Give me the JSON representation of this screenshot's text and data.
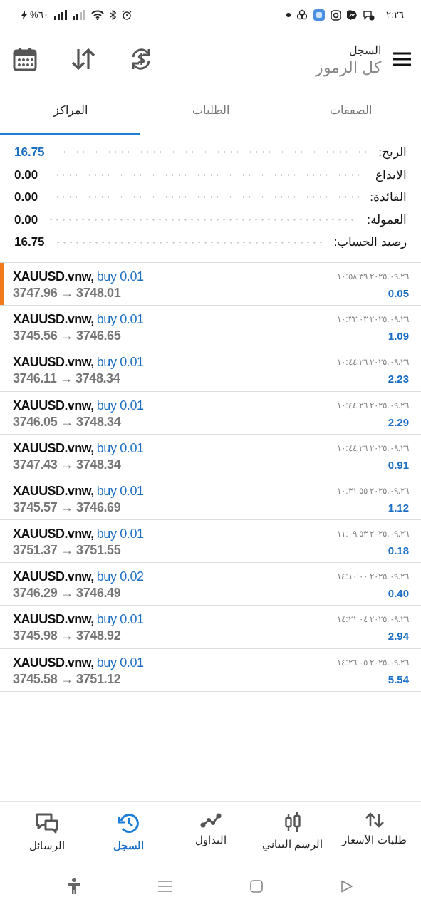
{
  "status_bar": {
    "time": "٢:٢٦",
    "battery": "%٦٠"
  },
  "header": {
    "title": "السجل",
    "subtitle": "كل الرموز"
  },
  "tabs": [
    {
      "label": "الصفقات",
      "selected": false
    },
    {
      "label": "الطلبات",
      "selected": false
    },
    {
      "label": "المراكز",
      "selected": true
    }
  ],
  "summary": [
    {
      "label": "الربح:",
      "value": "16.75",
      "color": "#1c6fc4"
    },
    {
      "label": "الايداع",
      "value": "0.00",
      "color": "#111111"
    },
    {
      "label": "الفائدة:",
      "value": "0.00",
      "color": "#111111"
    },
    {
      "label": "العمولة:",
      "value": "0.00",
      "color": "#111111"
    },
    {
      "label": "رصيد الحساب:",
      "value": "16.75",
      "color": "#111111"
    }
  ],
  "positions": [
    {
      "symbol": "XAUUSD.vnw,",
      "order": "buy 0.01",
      "prices": "3747.96 → 3748.01",
      "time": "٢٠٢٥.٠٩.٢٦ ١٠:٥٨:٣٩",
      "profit": "0.05",
      "selected": true
    },
    {
      "symbol": "XAUUSD.vnw,",
      "order": "buy 0.01",
      "prices": "3745.56 → 3746.65",
      "time": "٢٠٢٥.٠٩.٢٦ ١٠:٣٢:٠٣",
      "profit": "1.09",
      "selected": false
    },
    {
      "symbol": "XAUUSD.vnw,",
      "order": "buy 0.01",
      "prices": "3746.11 → 3748.34",
      "time": "٢٠٢٥.٠٩.٢٦ ١٠:٤٤:٢٦",
      "profit": "2.23",
      "selected": false
    },
    {
      "symbol": "XAUUSD.vnw,",
      "order": "buy 0.01",
      "prices": "3746.05 → 3748.34",
      "time": "٢٠٢٥.٠٩.٢٦ ١٠:٤٤:٢٦",
      "profit": "2.29",
      "selected": false
    },
    {
      "symbol": "XAUUSD.vnw,",
      "order": "buy 0.01",
      "prices": "3747.43 → 3748.34",
      "time": "٢٠٢٥.٠٩.٢٦ ١٠:٤٤:٢٦",
      "profit": "0.91",
      "selected": false
    },
    {
      "symbol": "XAUUSD.vnw,",
      "order": "buy 0.01",
      "prices": "3745.57 → 3746.69",
      "time": "٢٠٢٥.٠٩.٢٦ ١٠:٣١:٥٥",
      "profit": "1.12",
      "selected": false
    },
    {
      "symbol": "XAUUSD.vnw,",
      "order": "buy 0.01",
      "prices": "3751.37 → 3751.55",
      "time": "٢٠٢٥.٠٩.٢٦ ١١:٠٩:٥٣",
      "profit": "0.18",
      "selected": false
    },
    {
      "symbol": "XAUUSD.vnw,",
      "order": "buy 0.02",
      "prices": "3746.29 → 3746.49",
      "time": "٢٠٢٥.٠٩.٢٦ ١٤:١٠:٠٠",
      "profit": "0.40",
      "selected": false
    },
    {
      "symbol": "XAUUSD.vnw,",
      "order": "buy 0.01",
      "prices": "3745.98 → 3748.92",
      "time": "٢٠٢٥.٠٩.٢٦ ١٤:٢١:٠٤",
      "profit": "2.94",
      "selected": false
    },
    {
      "symbol": "XAUUSD.vnw,",
      "order": "buy 0.01",
      "prices": "3745.58 → 3751.12",
      "time": "٢٠٢٥.٠٩.٢٦ ١٤:٢٦:٠٥",
      "profit": "5.54",
      "selected": false
    }
  ],
  "bottom_nav": [
    {
      "label": "طلبات الأسعار",
      "selected": false
    },
    {
      "label": "الرسم البياني",
      "selected": false
    },
    {
      "label": "التداول",
      "selected": false
    },
    {
      "label": "السجل",
      "selected": true
    },
    {
      "label": "الرسائل",
      "selected": false
    }
  ]
}
